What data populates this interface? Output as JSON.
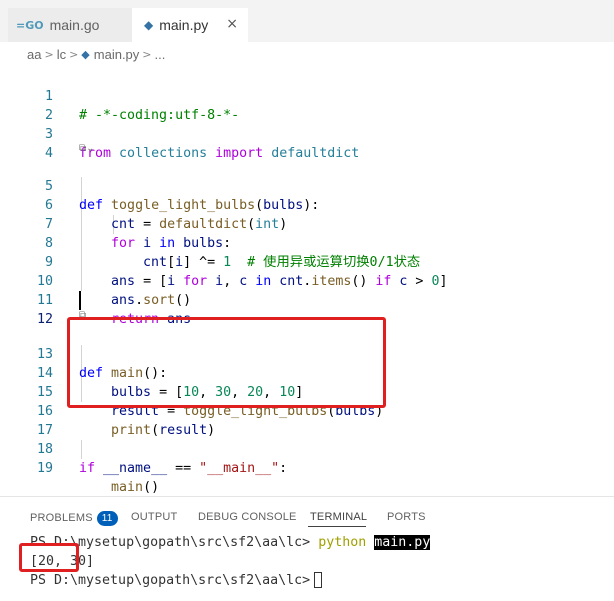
{
  "tabs": [
    {
      "label": "main.go",
      "icon": "go-icon"
    },
    {
      "label": "main.py",
      "icon": "python-icon",
      "close": "×"
    }
  ],
  "breadcrumb": {
    "parts": [
      "aa",
      "lc",
      "main.py",
      "..."
    ]
  },
  "code_lines": [
    {
      "n": "1",
      "text": "# -*-coding:utf-8-*-"
    },
    {
      "n": "2",
      "text": ""
    },
    {
      "n": "3",
      "text": "from collections import defaultdict"
    },
    {
      "n": "4",
      "text": ""
    },
    {
      "n": "5",
      "text": "def toggle_light_bulbs(bulbs):"
    },
    {
      "n": "6",
      "text": "    cnt = defaultdict(int)"
    },
    {
      "n": "7",
      "text": "    for i in bulbs:"
    },
    {
      "n": "8",
      "text": "        cnt[i] ^= 1  # 使用异或运算切换0/1状态"
    },
    {
      "n": "9",
      "text": "    ans = [i for i, c in cnt.items() if c > 0]"
    },
    {
      "n": "10",
      "text": "    ans.sort()"
    },
    {
      "n": "11",
      "text": "    return ans"
    },
    {
      "n": "12",
      "text": ""
    },
    {
      "n": "13",
      "text": "def main():"
    },
    {
      "n": "14",
      "text": "    bulbs = [10, 30, 20, 10]"
    },
    {
      "n": "15",
      "text": "    result = toggle_light_bulbs(bulbs)"
    },
    {
      "n": "16",
      "text": "    print(result)"
    },
    {
      "n": "17",
      "text": ""
    },
    {
      "n": "18",
      "text": "if __name__ == \"__main__\":"
    },
    {
      "n": "19",
      "text": "    main()"
    }
  ],
  "panel": {
    "tabs": [
      "PROBLEMS",
      "OUTPUT",
      "DEBUG CONSOLE",
      "TERMINAL",
      "PORTS"
    ],
    "problems_count": "11",
    "active_tab": "TERMINAL"
  },
  "terminal": {
    "prompt1": "PS D:\\mysetup\\gopath\\src\\sf2\\aa\\lc>",
    "cmd": "python",
    "arg": "main.py",
    "output": "[20, 30]",
    "prompt2": "PS D:\\mysetup\\gopath\\src\\sf2\\aa\\lc>"
  },
  "colors": {
    "highlight": "#e02020",
    "accent": "#005fb8"
  }
}
